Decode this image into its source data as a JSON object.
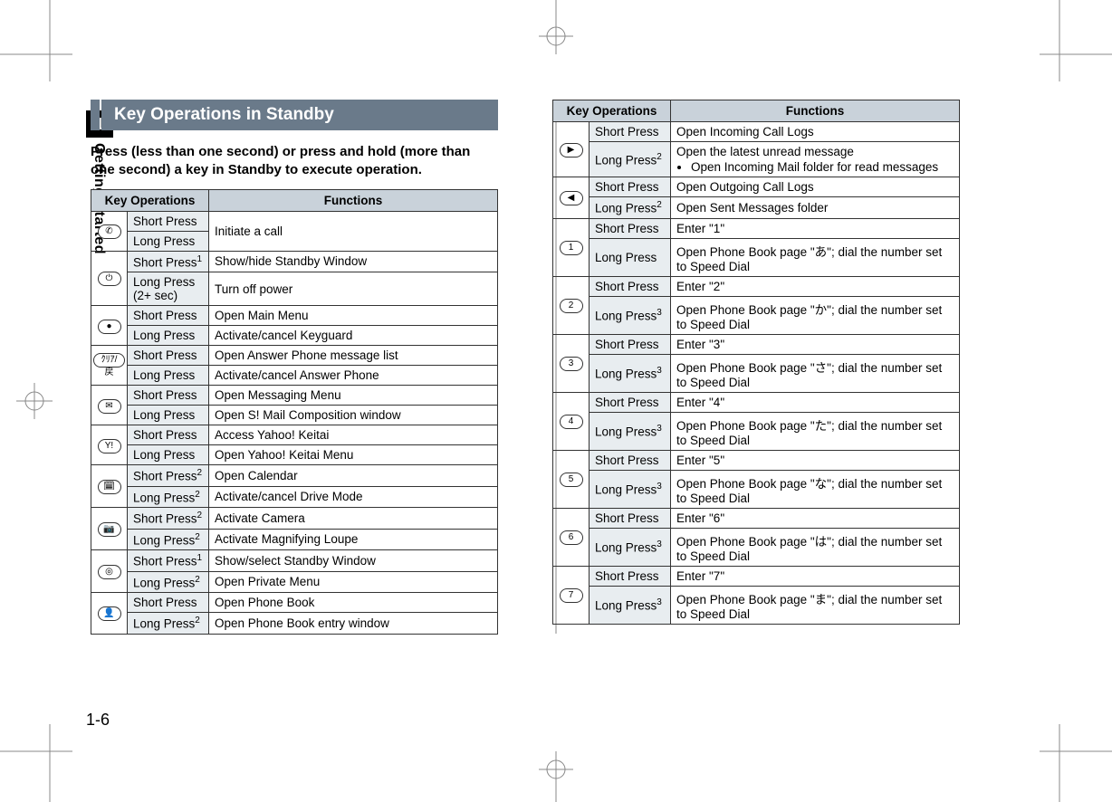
{
  "chapter": {
    "number": "1",
    "name": "Getting Started",
    "page": "1-6"
  },
  "section": {
    "title": "Key Operations in Standby",
    "intro": "Press (less than one second) or press and hold (more than one second) a key in Standby to execute operation."
  },
  "headers": {
    "keyops": "Key Operations",
    "functions": "Functions"
  },
  "left_rows": [
    {
      "icon": "call-icon",
      "glyph": "✆",
      "ops": [
        {
          "op": "Short Press",
          "sup": "",
          "fn": "Initiate a call",
          "rowspan_fn": 2
        },
        {
          "op": "Long Press",
          "sup": ""
        }
      ]
    },
    {
      "icon": "end-icon",
      "glyph": "⏻",
      "ops": [
        {
          "op": "Short Press",
          "sup": "1",
          "fn": "Show/hide Standby Window"
        },
        {
          "op": "Long Press (2+ sec)",
          "sup": "",
          "fn": "Turn off power"
        }
      ]
    },
    {
      "icon": "center-icon",
      "glyph": "●",
      "ops": [
        {
          "op": "Short Press",
          "sup": "",
          "fn": "Open Main Menu"
        },
        {
          "op": "Long Press",
          "sup": "",
          "fn": "Activate/cancel Keyguard"
        }
      ]
    },
    {
      "icon": "clear-icon",
      "glyph": "ｸﾘｱ/戻",
      "ops": [
        {
          "op": "Short Press",
          "sup": "",
          "fn": "Open Answer Phone message list"
        },
        {
          "op": "Long Press",
          "sup": "",
          "fn": "Activate/cancel Answer Phone"
        }
      ]
    },
    {
      "icon": "mail-icon",
      "glyph": "✉",
      "ops": [
        {
          "op": "Short Press",
          "sup": "",
          "fn": "Open Messaging Menu"
        },
        {
          "op": "Long Press",
          "sup": "",
          "fn": "Open S! Mail Composition window"
        }
      ]
    },
    {
      "icon": "yahoo-icon",
      "glyph": "Y!",
      "ops": [
        {
          "op": "Short Press",
          "sup": "",
          "fn": "Access Yahoo! Keitai"
        },
        {
          "op": "Long Press",
          "sup": "",
          "fn": "Open Yahoo! Keitai Menu"
        }
      ]
    },
    {
      "icon": "calendar-icon",
      "glyph": "🗓",
      "ops": [
        {
          "op": "Short Press",
          "sup": "2",
          "fn": "Open Calendar"
        },
        {
          "op": "Long Press",
          "sup": "2",
          "fn": "Activate/cancel Drive Mode"
        }
      ]
    },
    {
      "icon": "camera-icon",
      "glyph": "📷",
      "ops": [
        {
          "op": "Short Press",
          "sup": "2",
          "fn": "Activate Camera"
        },
        {
          "op": "Long Press",
          "sup": "2",
          "fn": "Activate Magnifying Loupe"
        }
      ]
    },
    {
      "icon": "shortcut-icon",
      "glyph": "◎",
      "ops": [
        {
          "op": "Short Press",
          "sup": "1",
          "fn": "Show/select Standby Window"
        },
        {
          "op": "Long Press",
          "sup": "2",
          "fn": "Open Private Menu"
        }
      ]
    },
    {
      "icon": "phonebook-icon",
      "glyph": "👤",
      "ops": [
        {
          "op": "Short Press",
          "sup": "",
          "fn": "Open Phone Book"
        },
        {
          "op": "Long Press",
          "sup": "2",
          "fn": "Open Phone Book entry window"
        }
      ]
    }
  ],
  "right_rows": [
    {
      "icon": "right-arrow-icon",
      "glyph": "▶",
      "ops": [
        {
          "op": "Short Press",
          "sup": "",
          "fn": "Open Incoming Call Logs"
        },
        {
          "op": "Long Press",
          "sup": "2",
          "fn": "Open the latest unread message",
          "bullet": "Open Incoming Mail folder for read messages"
        }
      ]
    },
    {
      "icon": "left-arrow-icon",
      "glyph": "◀",
      "ops": [
        {
          "op": "Short Press",
          "sup": "",
          "fn": "Open Outgoing Call Logs"
        },
        {
          "op": "Long Press",
          "sup": "2",
          "fn": "Open Sent Messages folder"
        }
      ]
    },
    {
      "icon": "key-1-icon",
      "glyph": "1",
      "ops": [
        {
          "op": "Short Press",
          "sup": "",
          "fn": "Enter \"1\""
        },
        {
          "op": "Long Press",
          "sup": "",
          "fn": "Open Phone Book page \"あ\"; dial the number set to Speed Dial"
        }
      ]
    },
    {
      "icon": "key-2-icon",
      "glyph": "2",
      "ops": [
        {
          "op": "Short Press",
          "sup": "",
          "fn": "Enter \"2\""
        },
        {
          "op": "Long Press",
          "sup": "3",
          "fn": "Open Phone Book page \"か\"; dial the number set to Speed Dial"
        }
      ]
    },
    {
      "icon": "key-3-icon",
      "glyph": "3",
      "ops": [
        {
          "op": "Short Press",
          "sup": "",
          "fn": "Enter \"3\""
        },
        {
          "op": "Long Press",
          "sup": "3",
          "fn": "Open Phone Book page \"さ\"; dial the number set to Speed Dial"
        }
      ]
    },
    {
      "icon": "key-4-icon",
      "glyph": "4",
      "ops": [
        {
          "op": "Short Press",
          "sup": "",
          "fn": "Enter \"4\""
        },
        {
          "op": "Long Press",
          "sup": "3",
          "fn": "Open Phone Book page \"た\"; dial the number set to Speed Dial"
        }
      ]
    },
    {
      "icon": "key-5-icon",
      "glyph": "5",
      "ops": [
        {
          "op": "Short Press",
          "sup": "",
          "fn": "Enter \"5\""
        },
        {
          "op": "Long Press",
          "sup": "3",
          "fn": "Open Phone Book page \"な\"; dial the number set to Speed Dial"
        }
      ]
    },
    {
      "icon": "key-6-icon",
      "glyph": "6",
      "ops": [
        {
          "op": "Short Press",
          "sup": "",
          "fn": "Enter \"6\""
        },
        {
          "op": "Long Press",
          "sup": "3",
          "fn": "Open Phone Book page \"は\"; dial the number set to Speed Dial"
        }
      ]
    },
    {
      "icon": "key-7-icon",
      "glyph": "7",
      "ops": [
        {
          "op": "Short Press",
          "sup": "",
          "fn": "Enter \"7\""
        },
        {
          "op": "Long Press",
          "sup": "3",
          "fn": "Open Phone Book page \"ま\"; dial the number set to Speed Dial"
        }
      ]
    }
  ]
}
